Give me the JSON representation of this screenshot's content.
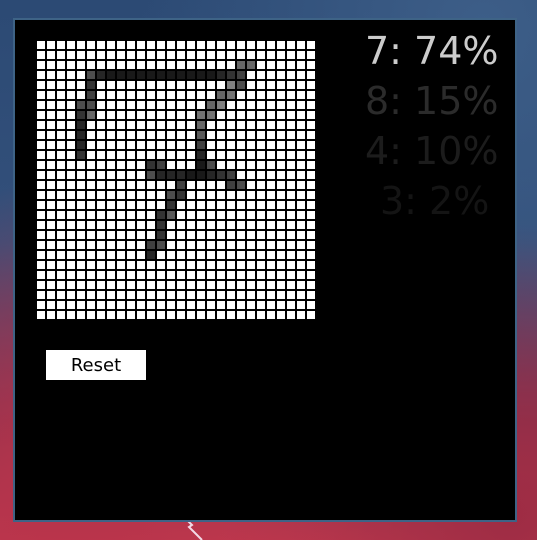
{
  "predictions": [
    {
      "digit": "7",
      "percent": 74,
      "label": "7: 74%"
    },
    {
      "digit": "8",
      "percent": 15,
      "label": "8: 15%"
    },
    {
      "digit": "4",
      "percent": 10,
      "label": "4: 10%"
    },
    {
      "digit": "3",
      "percent": 2,
      "label": "3: 2%"
    }
  ],
  "reset_label": "Reset",
  "drawing_grid": {
    "rows": 28,
    "cols": 28,
    "cell_color": "#ffffff",
    "ink_color": "#000000",
    "inked_cells": [
      [
        2,
        20,
        0.6
      ],
      [
        2,
        21,
        0.6
      ],
      [
        3,
        5,
        0.7
      ],
      [
        3,
        6,
        0.85
      ],
      [
        3,
        7,
        0.9
      ],
      [
        3,
        8,
        0.9
      ],
      [
        3,
        9,
        0.9
      ],
      [
        3,
        10,
        0.9
      ],
      [
        3,
        11,
        0.9
      ],
      [
        3,
        12,
        0.9
      ],
      [
        3,
        13,
        0.9
      ],
      [
        3,
        14,
        0.9
      ],
      [
        3,
        15,
        0.9
      ],
      [
        3,
        16,
        0.9
      ],
      [
        3,
        17,
        0.9
      ],
      [
        3,
        18,
        0.85
      ],
      [
        3,
        19,
        0.8
      ],
      [
        3,
        20,
        0.75
      ],
      [
        4,
        5,
        0.8
      ],
      [
        4,
        20,
        0.7
      ],
      [
        4,
        19,
        0.5
      ],
      [
        5,
        5,
        0.75
      ],
      [
        5,
        18,
        0.6
      ],
      [
        5,
        19,
        0.55
      ],
      [
        6,
        4,
        0.7
      ],
      [
        6,
        5,
        0.7
      ],
      [
        6,
        17,
        0.6
      ],
      [
        6,
        18,
        0.5
      ],
      [
        7,
        4,
        0.8
      ],
      [
        7,
        5,
        0.6
      ],
      [
        7,
        16,
        0.55
      ],
      [
        7,
        17,
        0.55
      ],
      [
        8,
        4,
        0.85
      ],
      [
        8,
        16,
        0.6
      ],
      [
        9,
        4,
        0.85
      ],
      [
        9,
        16,
        0.65
      ],
      [
        10,
        4,
        0.85
      ],
      [
        10,
        16,
        0.75
      ],
      [
        11,
        4,
        0.8
      ],
      [
        11,
        16,
        0.85
      ],
      [
        12,
        11,
        0.8
      ],
      [
        12,
        12,
        0.75
      ],
      [
        12,
        16,
        0.9
      ],
      [
        12,
        17,
        0.7
      ],
      [
        13,
        11,
        0.7
      ],
      [
        13,
        12,
        0.85
      ],
      [
        13,
        13,
        0.85
      ],
      [
        13,
        14,
        0.85
      ],
      [
        13,
        15,
        0.9
      ],
      [
        13,
        16,
        0.9
      ],
      [
        13,
        17,
        0.85
      ],
      [
        13,
        18,
        0.8
      ],
      [
        13,
        19,
        0.75
      ],
      [
        14,
        14,
        0.75
      ],
      [
        14,
        19,
        0.75
      ],
      [
        14,
        20,
        0.7
      ],
      [
        15,
        13,
        0.7
      ],
      [
        15,
        14,
        0.8
      ],
      [
        16,
        13,
        0.8
      ],
      [
        17,
        12,
        0.8
      ],
      [
        17,
        13,
        0.65
      ],
      [
        18,
        12,
        0.8
      ],
      [
        19,
        12,
        0.8
      ],
      [
        20,
        11,
        0.75
      ],
      [
        20,
        12,
        0.7
      ],
      [
        21,
        11,
        0.85
      ]
    ]
  }
}
